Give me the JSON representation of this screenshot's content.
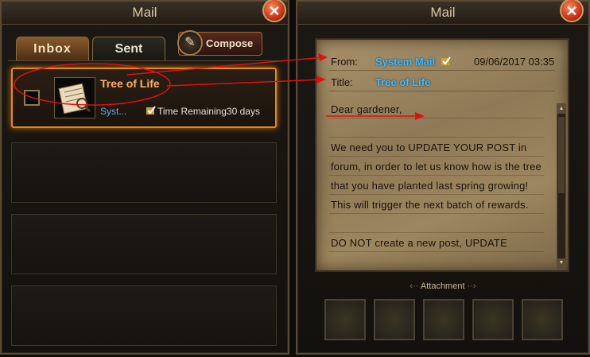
{
  "left_panel": {
    "title": "Mail",
    "close_glyph": "✕",
    "tabs": [
      {
        "label": "Inbox",
        "active": true
      },
      {
        "label": "Sent",
        "active": false
      }
    ],
    "compose_label": "Compose",
    "mail_items": [
      {
        "subject": "Tree of Life",
        "sender": "Syst...",
        "time_remaining_label": "Time Remaining",
        "time_remaining_value": "30 days",
        "icon": "scroll-letter-icon"
      }
    ]
  },
  "right_panel": {
    "title": "Mail",
    "close_glyph": "✕",
    "from_label": "From:",
    "from_value": "System Mail",
    "date": "09/06/2017 03:35",
    "title_label": "Title:",
    "title_value": "Tree of Life",
    "body": "Dear gardener,\n\nWe need you to UPDATE YOUR POST in forum, in order to let us know how is the tree that you have planted last spring growing! This will trigger the next batch of rewards.\n\nDO NOT create a new post, UPDATE",
    "attachment_label": "Attachment"
  },
  "colors": {
    "highlight_orange": "#e08a20",
    "link_blue": "#4ab8f0",
    "annotation_red": "#e01010"
  }
}
